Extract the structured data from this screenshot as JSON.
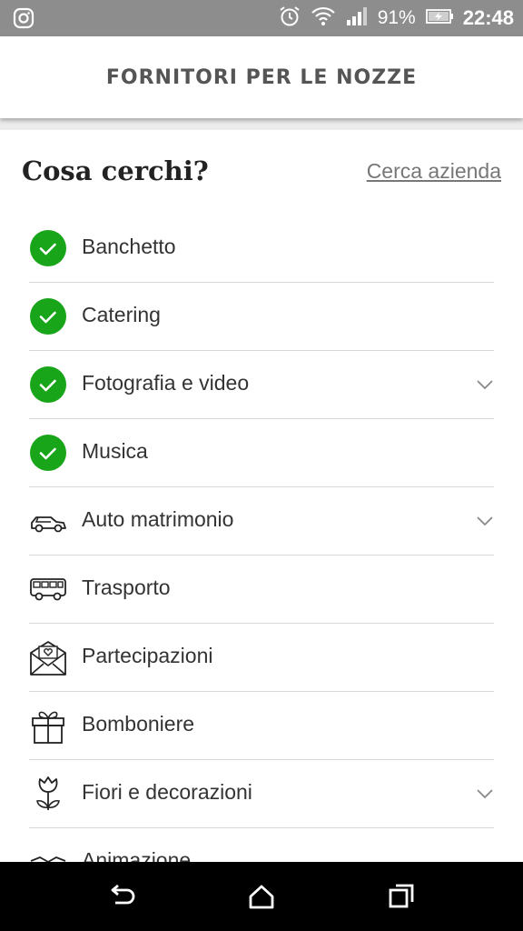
{
  "status_bar": {
    "battery": "91%",
    "time": "22:48",
    "icons": [
      "instagram-icon",
      "alarm-icon",
      "wifi-icon",
      "signal-icon",
      "battery-charging-icon"
    ]
  },
  "header": {
    "title": "FORNITORI PER LE NOZZE"
  },
  "section": {
    "title": "Cosa cerchi?",
    "search_link": "Cerca azienda"
  },
  "categories": [
    {
      "label": "Banchetto",
      "icon": "check-circle-icon",
      "selected": true,
      "expandable": false
    },
    {
      "label": "Catering",
      "icon": "check-circle-icon",
      "selected": true,
      "expandable": false
    },
    {
      "label": "Fotografia e video",
      "icon": "check-circle-icon",
      "selected": true,
      "expandable": true
    },
    {
      "label": "Musica",
      "icon": "check-circle-icon",
      "selected": true,
      "expandable": false
    },
    {
      "label": "Auto matrimonio",
      "icon": "car-icon",
      "selected": false,
      "expandable": true
    },
    {
      "label": "Trasporto",
      "icon": "bus-icon",
      "selected": false,
      "expandable": false
    },
    {
      "label": "Partecipazioni",
      "icon": "envelope-heart-icon",
      "selected": false,
      "expandable": false
    },
    {
      "label": "Bomboniere",
      "icon": "gift-icon",
      "selected": false,
      "expandable": false
    },
    {
      "label": "Fiori e decorazioni",
      "icon": "tulip-icon",
      "selected": false,
      "expandable": true
    },
    {
      "label": "Animazione",
      "icon": "animation-icon",
      "selected": false,
      "expandable": false
    }
  ],
  "colors": {
    "selected_green": "#19a519",
    "status_bar": "#8d8d8d"
  },
  "nav": {
    "buttons": [
      "back-icon",
      "home-icon",
      "recents-icon"
    ]
  }
}
